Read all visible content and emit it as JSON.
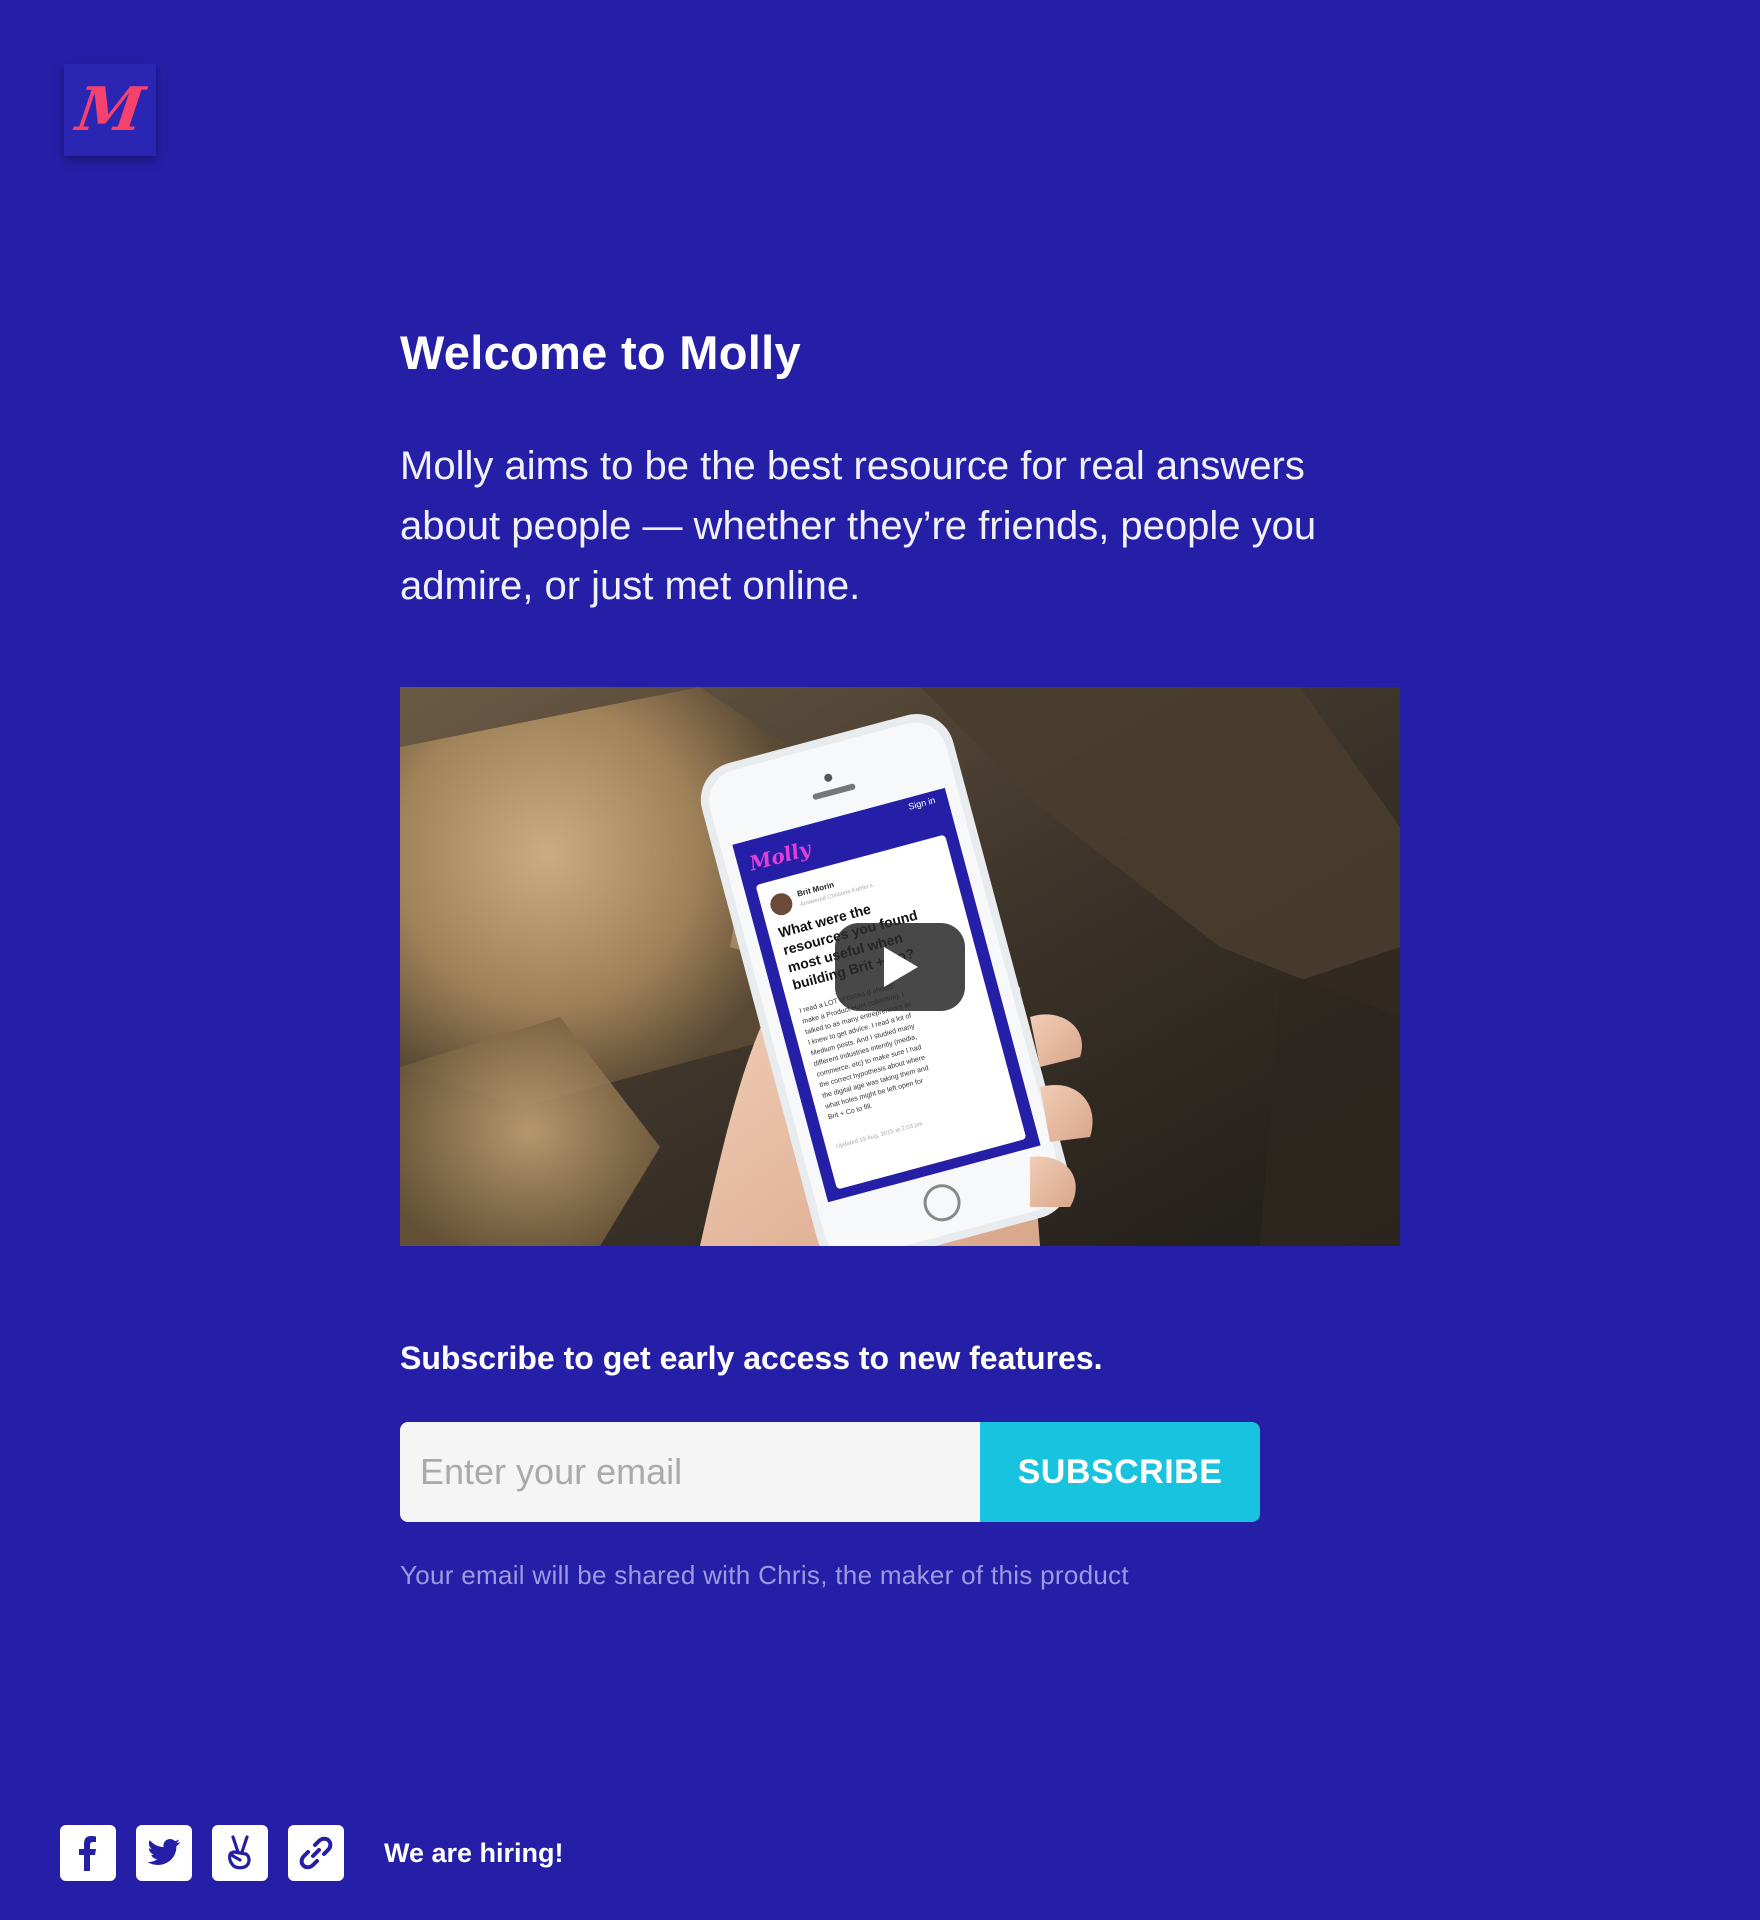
{
  "logo": {
    "text": "M"
  },
  "hero": {
    "title": "Welcome to Molly",
    "intro": "Molly aims to be the best resource for real answers about people — whether they’re friends, people you admire, or just met online."
  },
  "video": {
    "phone_brand": "Molly",
    "phone_signin": "Sign in",
    "post_author": "Brit Morin",
    "post_author_sub": "Answered Christina Kahler's question",
    "post_question": "What were the resources you found most useful when building Brit + Co?",
    "post_body": "I read a LOT of books (I should make a Product Hunt collection). I talked to as many entrepreneurs as I knew to get advice. I read a lot of Medium posts. And I studied many different industries intently (media, commerce, etc) to make sure I had the correct hypothesis about where the digital age was taking them and what holes might be left open for Brit + Co to fill.",
    "post_updated": "Updated 19 Aug, 2015 at 2:03 pm"
  },
  "subscribe": {
    "heading": "Subscribe to get early access to new features.",
    "placeholder": "Enter your email",
    "button_label": "SUBSCRIBE",
    "disclaimer": "Your email will be shared with Chris, the maker of this product"
  },
  "footer": {
    "hiring_label": "We are hiring!",
    "icons": [
      "facebook-icon",
      "twitter-icon",
      "angellist-icon",
      "link-icon"
    ]
  },
  "colors": {
    "background": "#251fa8",
    "accent": "#17c3de",
    "logo_red": "#f5416c",
    "disclaimer": "#9d9ae0"
  }
}
